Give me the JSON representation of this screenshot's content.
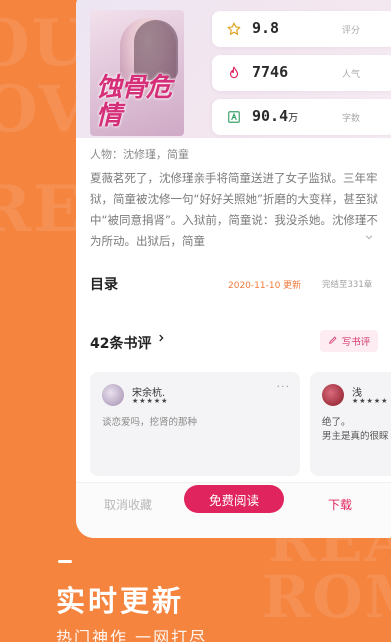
{
  "stats": [
    {
      "icon": "star-icon",
      "value": "9.8",
      "unit": "",
      "label": "评分"
    },
    {
      "icon": "flame-icon",
      "value": "7746",
      "unit": "",
      "label": "人气"
    },
    {
      "icon": "word-count-icon",
      "value": "90.4",
      "unit": "万",
      "label": "字数"
    }
  ],
  "book": {
    "cover_title": "蚀骨危情",
    "characters": "人物：沈修瑾，简童",
    "synopsis": "夏薇茗死了，沈修瑾亲手将简童送进了女子监狱。三年牢狱，简童被沈修一句“好好关照她”折磨的大变样，甚至狱中“被同意捐肾”。入狱前，简童说：我没杀她。沈修瑾不为所动。出狱后，简童"
  },
  "toc": {
    "title": "目录",
    "update_date": "2020-11-10 更新",
    "status": "完结至331章"
  },
  "reviews": {
    "title": "42条书评",
    "write_label": "写书评",
    "items": [
      {
        "name": "宋余杭.",
        "stars": "★★★★★",
        "text": "谈恋爱吗，挖肾的那种"
      },
      {
        "name": "浅",
        "stars": "★★★★★",
        "text": "绝了。\n男主是真的很睬"
      }
    ]
  },
  "actions": {
    "cancel": "取消收藏",
    "read": "免费阅读",
    "download": "下载"
  },
  "promo": {
    "headline": "实时更新",
    "subline": "热门神作 一网打尽"
  },
  "colors": {
    "background": "#f5843f",
    "accent": "#e0245e",
    "update_date": "#f2793a"
  }
}
